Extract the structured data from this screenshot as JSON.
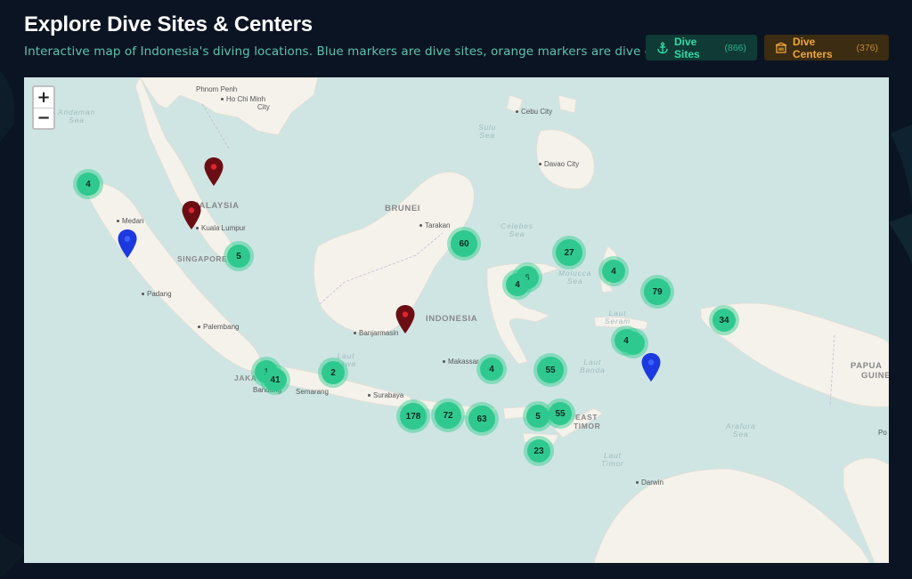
{
  "header": {
    "title": "Explore Dive Sites & Centers",
    "subtitle": "Interactive map of Indonesia's diving locations. Blue markers are dive sites, orange markers are dive centers."
  },
  "filters": {
    "dive_sites": {
      "label": "Dive Sites",
      "count": "(866)",
      "icon": "anchor-icon",
      "color": "#2fdca6"
    },
    "dive_centers": {
      "label": "Dive Centers",
      "count": "(376)",
      "icon": "building-icon",
      "color": "#f0a637"
    }
  },
  "map": {
    "zoom_in": "+",
    "zoom_out": "−",
    "colors": {
      "water": "#cfe5e4",
      "land": "#f5f2ec",
      "cluster": "#2fc990",
      "site_pin": "#1c39e0",
      "center_pin": "#6b0e14"
    },
    "labels": {
      "phnom_penh": "Phnom Penh",
      "ho_chi_minh": "Ho Chi Minh",
      "city": "City",
      "andaman": "Andaman",
      "sea": "Sea",
      "cebu": "Cebu City",
      "sulu": "Sulu",
      "davao": "Davao City",
      "malaysia": "MALAYSIA",
      "brunei": "BRUNEI",
      "medan": "Medan",
      "kuala_lumpur": "Kuala Lumpur",
      "singapore": "SINGAPORE",
      "tarakan": "Tarakan",
      "celebes": "Celebes",
      "molucca": "Molucca",
      "padang": "Padang",
      "palembang": "Palembang",
      "banjarmasin": "Banjarmasin",
      "indonesia": "INDONESIA",
      "laut": "Laut",
      "jawa": "Jawa",
      "seram": "Seram",
      "banda": "Banda",
      "makassar": "Makassar",
      "jakarta": "JAKA",
      "bandung": "Bandung",
      "semarang": "Semarang",
      "surabaya": "Surabaya",
      "papua": "PAPUA",
      "guinea": "GUINE",
      "east": "EAST",
      "timor": "TIMOR",
      "laut_timor": "Timor",
      "arafura": "Arafura",
      "darwin": "Darwin",
      "po": "Po"
    },
    "clusters": [
      "4",
      "5",
      "60",
      "27",
      "4",
      "4",
      "79",
      "6",
      "4",
      "34",
      "4",
      "2",
      "1",
      "41",
      "55",
      "178",
      "72",
      "63",
      "5",
      "55",
      "23",
      "4"
    ],
    "pins": {
      "site": "dive-site-pin",
      "center": "dive-center-pin"
    }
  }
}
